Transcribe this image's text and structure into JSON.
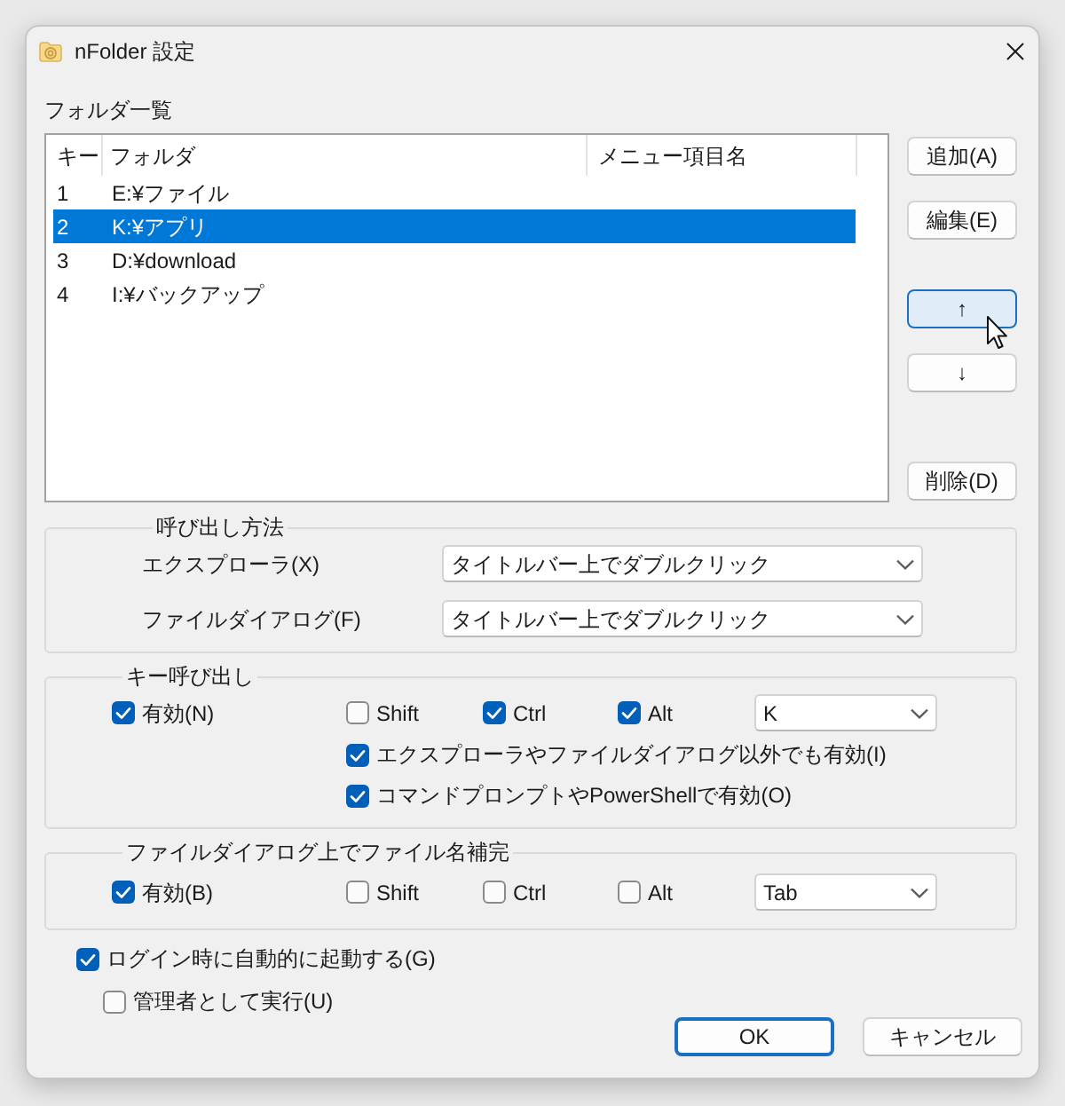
{
  "window": {
    "title": "nFolder 設定"
  },
  "folder_list": {
    "label": "フォルダ一覧",
    "columns": [
      "キー",
      "フォルダ",
      "メニュー項目名"
    ],
    "rows": [
      {
        "key": "1",
        "folder": "E:¥ファイル",
        "selected": false
      },
      {
        "key": "2",
        "folder": "K:¥アプリ",
        "selected": true
      },
      {
        "key": "3",
        "folder": "D:¥download",
        "selected": false
      },
      {
        "key": "4",
        "folder": "I:¥バックアップ",
        "selected": false
      }
    ]
  },
  "list_button_groups": [
    [
      {
        "label": "追加(A)",
        "hovered": false
      },
      {
        "label": "編集(E)",
        "hovered": false
      }
    ],
    [
      {
        "label": "↑",
        "hovered": true
      },
      {
        "label": "↓",
        "hovered": false
      }
    ],
    [
      {
        "label": "削除(D)",
        "hovered": false
      }
    ]
  ],
  "call_method": {
    "title": "呼び出し方法",
    "rows": [
      {
        "label": "エクスプローラ(X)",
        "value": "タイトルバー上でダブルクリック"
      },
      {
        "label": "ファイルダイアログ(F)",
        "value": "タイトルバー上でダブルクリック"
      }
    ]
  },
  "key_call": {
    "title": "キー呼び出し",
    "enable": {
      "label": "有効(N)",
      "checked": true
    },
    "modifiers": [
      {
        "label": "Shift",
        "checked": false
      },
      {
        "label": "Ctrl",
        "checked": true
      },
      {
        "label": "Alt",
        "checked": true
      }
    ],
    "key": "K",
    "options": [
      {
        "label": "エクスプローラやファイルダイアログ以外でも有効(I)",
        "checked": true
      },
      {
        "label": "コマンドプロンプトやPowerShellで有効(O)",
        "checked": true
      }
    ]
  },
  "filename_completion": {
    "title": "ファイルダイアログ上でファイル名補完",
    "enable": {
      "label": "有効(B)",
      "checked": true
    },
    "modifiers": [
      {
        "label": "Shift",
        "checked": false
      },
      {
        "label": "Ctrl",
        "checked": false
      },
      {
        "label": "Alt",
        "checked": false
      }
    ],
    "key": "Tab"
  },
  "startup_options": [
    {
      "label": "ログイン時に自動的に起動する(G)",
      "checked": true,
      "children": [
        {
          "label": "管理者として実行(U)",
          "checked": false
        }
      ]
    }
  ],
  "dialog_buttons": [
    {
      "label": "OK",
      "focused": true
    },
    {
      "label": "キャンセル",
      "focused": false
    }
  ]
}
